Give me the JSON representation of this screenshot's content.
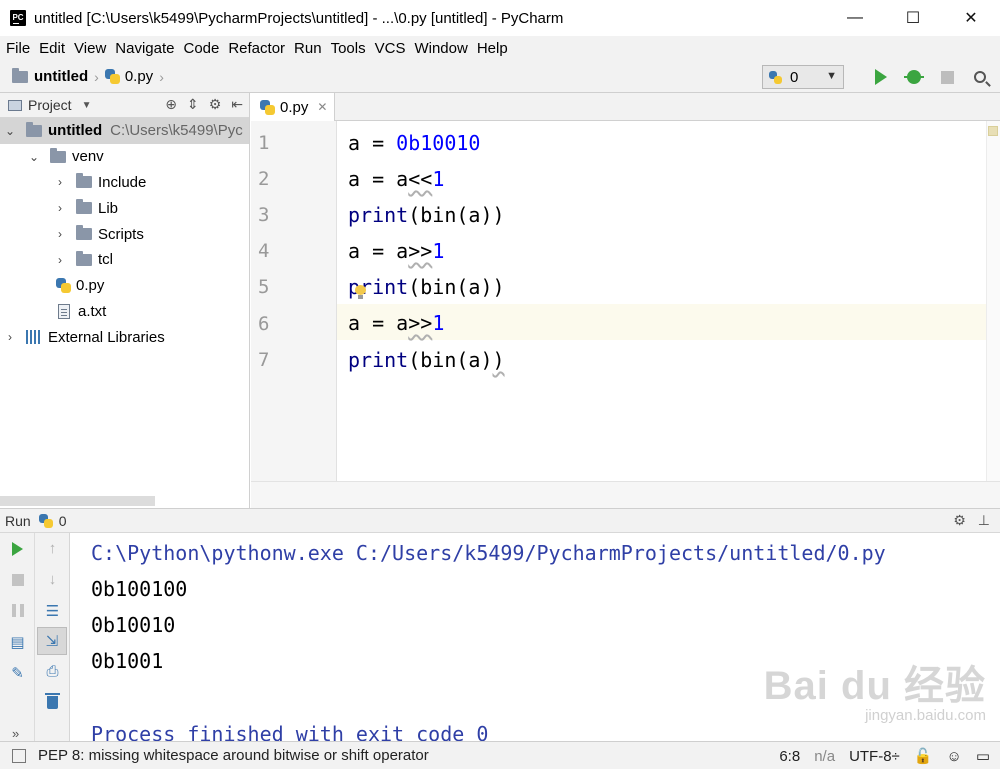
{
  "titlebar": {
    "logo_text": "PC",
    "title": "untitled [C:\\Users\\k5499\\PycharmProjects\\untitled] - ...\\0.py [untitled] - PyCharm",
    "minimize": "—",
    "maximize": "☐",
    "close": "✕"
  },
  "menu": {
    "items": [
      "File",
      "Edit",
      "View",
      "Navigate",
      "Code",
      "Refactor",
      "Run",
      "Tools",
      "VCS",
      "Window",
      "Help"
    ]
  },
  "navbar": {
    "project": "untitled",
    "file": "0.py",
    "run_config": "0"
  },
  "project_panel": {
    "title": "Project",
    "tree": [
      {
        "label": "untitled",
        "path": "C:\\Users\\k5499\\Pyc"
      },
      {
        "label": "venv"
      },
      {
        "label": "Include"
      },
      {
        "label": "Lib"
      },
      {
        "label": "Scripts"
      },
      {
        "label": "tcl"
      },
      {
        "label": "0.py"
      },
      {
        "label": "a.txt"
      },
      {
        "label": "External Libraries"
      }
    ]
  },
  "editor": {
    "tab": "0.py",
    "line_numbers": [
      "1",
      "2",
      "3",
      "4",
      "5",
      "6",
      "7"
    ],
    "lines": [
      {
        "a": "a = ",
        "b": "0b10010"
      },
      {
        "a": "a = a",
        "b": "<<",
        "c": "1"
      },
      {
        "a": "print",
        "b": "(bin(a))"
      },
      {
        "a": "a = a",
        "b": ">>",
        "c": "1"
      },
      {
        "a": "print",
        "b": "(bin(a))"
      },
      {
        "a": "a = a",
        "b": ">>",
        "c": "1"
      },
      {
        "a": "print",
        "b": "(bin(a)",
        "c": ")"
      }
    ]
  },
  "run_panel": {
    "label": "Run",
    "config": "0",
    "console": [
      "C:\\Python\\pythonw.exe C:/Users/k5499/PycharmProjects/untitled/0.py",
      "0b100100",
      "0b10010",
      "0b1001",
      "Process finished with exit code 0"
    ]
  },
  "watermark": {
    "main": "Bai du 经验",
    "sub": "jingyan.baidu.com"
  },
  "statusbar": {
    "message": "PEP 8: missing whitespace around bitwise or shift operator",
    "position": "6:8",
    "na": "n/a",
    "encoding": "UTF-8÷"
  },
  "colors": {
    "keyword": "#000080",
    "number": "#0000ff",
    "console_path": "#2f3fa6",
    "run_green": "#3ba540"
  }
}
